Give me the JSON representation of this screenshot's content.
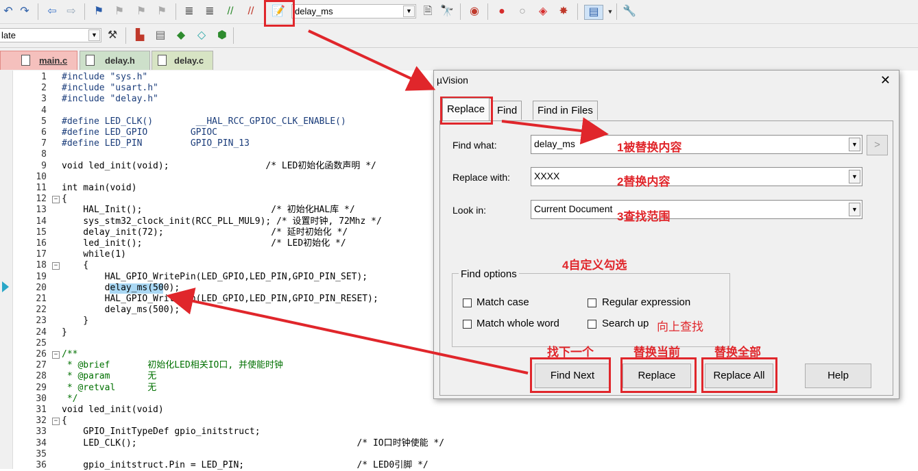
{
  "toolbar1": {
    "find_combo_value": "delay_ms"
  },
  "toolbar2": {
    "target_combo_value": "late"
  },
  "file_tabs": [
    {
      "label": "main.c",
      "active": true
    },
    {
      "label": "delay.h",
      "active": false
    },
    {
      "label": "delay.c",
      "active": false
    }
  ],
  "editor": {
    "lines": [
      {
        "n": "1",
        "t": "#include \"sys.h\""
      },
      {
        "n": "2",
        "t": "#include \"usart.h\""
      },
      {
        "n": "3",
        "t": "#include \"delay.h\""
      },
      {
        "n": "4",
        "t": ""
      },
      {
        "n": "5",
        "t": "#define LED_CLK()        __HAL_RCC_GPIOC_CLK_ENABLE()"
      },
      {
        "n": "6",
        "t": "#define LED_GPIO        GPIOC"
      },
      {
        "n": "7",
        "t": "#define LED_PIN         GPIO_PIN_13"
      },
      {
        "n": "8",
        "t": ""
      },
      {
        "n": "9",
        "t": "void led_init(void);                  /* LED初始化函数声明 */"
      },
      {
        "n": "10",
        "t": ""
      },
      {
        "n": "11",
        "t": "int main(void)"
      },
      {
        "n": "12",
        "t": "{"
      },
      {
        "n": "13",
        "t": "    HAL_Init();                        /* 初始化HAL库 */"
      },
      {
        "n": "14",
        "t": "    sys_stm32_clock_init(RCC_PLL_MUL9); /* 设置时钟, 72Mhz */"
      },
      {
        "n": "15",
        "t": "    delay_init(72);                    /* 延时初始化 */"
      },
      {
        "n": "16",
        "t": "    led_init();                        /* LED初始化 */"
      },
      {
        "n": "17",
        "t": "    while(1)"
      },
      {
        "n": "18",
        "t": "    {"
      },
      {
        "n": "19",
        "t": "        HAL_GPIO_WritePin(LED_GPIO,LED_PIN,GPIO_PIN_SET);"
      },
      {
        "n": "20",
        "t": "        delay_ms(500);"
      },
      {
        "n": "21",
        "t": "        HAL_GPIO_WritePin(LED_GPIO,LED_PIN,GPIO_PIN_RESET);"
      },
      {
        "n": "22",
        "t": "        delay_ms(500);"
      },
      {
        "n": "23",
        "t": "    }"
      },
      {
        "n": "24",
        "t": "}"
      },
      {
        "n": "25",
        "t": ""
      },
      {
        "n": "26",
        "t": "/**"
      },
      {
        "n": "27",
        "t": " * @brief       初始化LED相关IO口, 并使能时钟"
      },
      {
        "n": "28",
        "t": " * @param       无"
      },
      {
        "n": "29",
        "t": " * @retval      无"
      },
      {
        "n": "30",
        "t": " */"
      },
      {
        "n": "31",
        "t": "void led_init(void)"
      },
      {
        "n": "32",
        "t": "{"
      },
      {
        "n": "33",
        "t": "    GPIO_InitTypeDef gpio_initstruct;"
      },
      {
        "n": "34",
        "t": "    LED_CLK();                                         /* IO口时钟使能 */"
      },
      {
        "n": "35",
        "t": ""
      },
      {
        "n": "36",
        "t": "    gpio_initstruct.Pin = LED_PIN;                     /* LED0引脚 */"
      }
    ]
  },
  "dialog": {
    "title": "µVision",
    "close": "✕",
    "tabs": [
      "Replace",
      "Find",
      "Find in Files"
    ],
    "find_what_label": "Find what:",
    "find_what_value": "delay_ms",
    "replace_with_label": "Replace with:",
    "replace_with_value": "XXXX",
    "look_in_label": "Look in:",
    "look_in_value": "Current Document",
    "find_options_title": "Find options",
    "match_case": "Match case",
    "match_whole_word": "Match whole word",
    "regular_expression": "Regular expression",
    "search_up": "Search up",
    "buttons": {
      "find_next": "Find Next",
      "replace": "Replace",
      "replace_all": "Replace All",
      "help": "Help",
      "more": ">"
    }
  },
  "annotations": {
    "a1": "1被替换内容",
    "a2": "2替换内容",
    "a3": "3查找范围",
    "a4": "4自定义勾选",
    "search_up_note": "向上查找",
    "find_next_note": "找下一个",
    "replace_note": "替换当前",
    "replace_all_note": "替换全部"
  },
  "colors": {
    "annotation_red": "#e0262b",
    "selection_blue": "#aad8f4"
  }
}
